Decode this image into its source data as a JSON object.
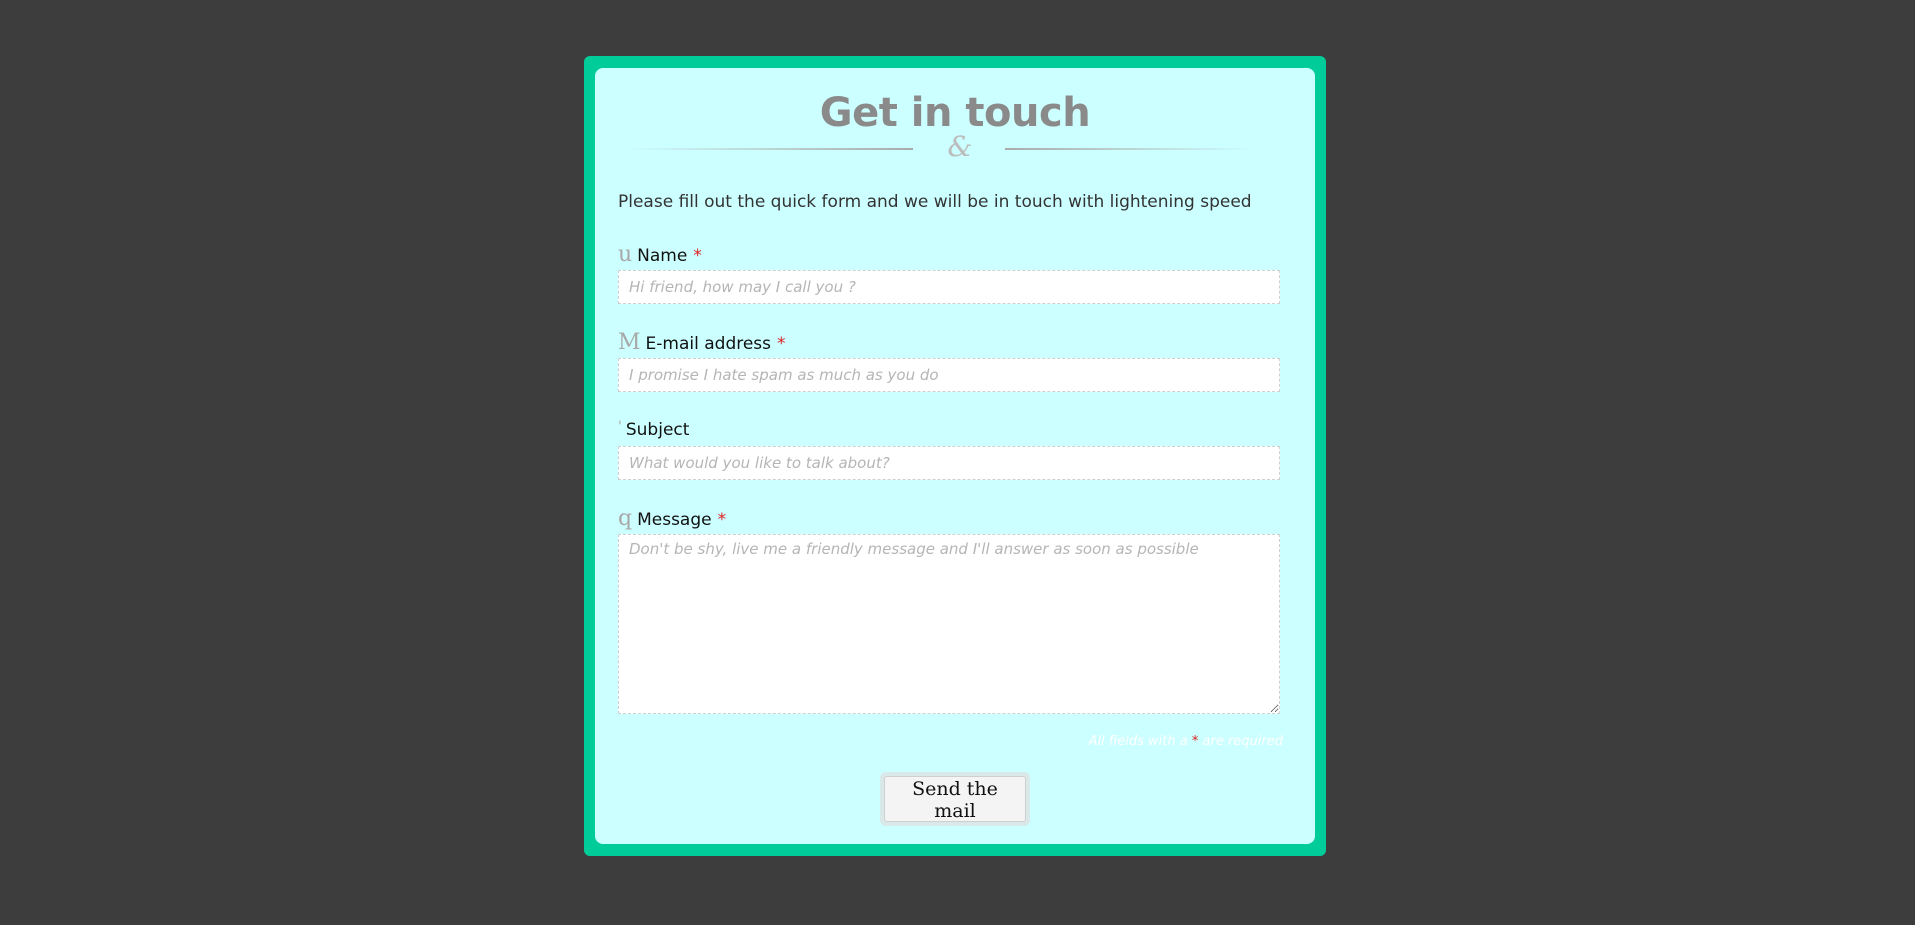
{
  "form": {
    "title": "Get in touch",
    "ampersand": "&",
    "intro": "Please fill out the quick form and we will be in touch with lightening speed",
    "required_mark": "*",
    "fields": {
      "name": {
        "icon": "u",
        "icon_name": "user-icon",
        "label": "Name",
        "placeholder": "Hi friend, how may I call you ?",
        "required": true
      },
      "email": {
        "icon": "M",
        "icon_name": "mail-icon",
        "label": "E-mail address",
        "placeholder": "I promise I hate spam as much as you do",
        "required": true
      },
      "subject": {
        "icon": "'",
        "icon_name": "subject-icon",
        "label": "Subject",
        "placeholder": "What would you like to talk about?",
        "required": false
      },
      "message": {
        "icon": "q",
        "icon_name": "message-icon",
        "label": "Message",
        "placeholder": "Don't be shy, live me a friendly message and I'll answer as soon as possible",
        "required": true
      }
    },
    "required_note_before": "All fields with a",
    "required_note_after": "are required",
    "submit_label": "Send the mail"
  },
  "colors": {
    "page_background": "#3d3d3d",
    "frame": "#00cc99",
    "card": "#ccffff",
    "required": "#dd2222"
  }
}
